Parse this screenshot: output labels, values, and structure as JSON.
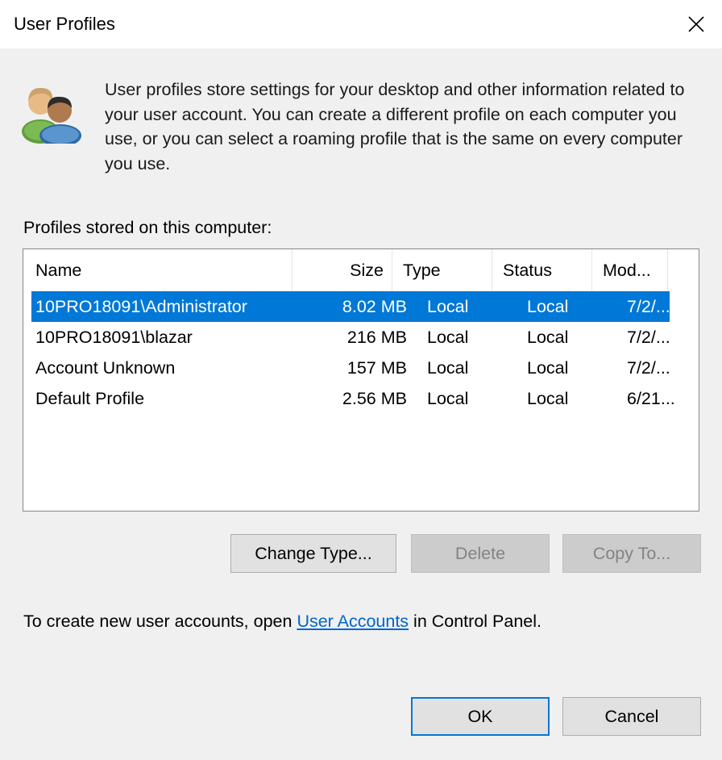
{
  "window": {
    "title": "User Profiles",
    "close_icon": "close-icon"
  },
  "intro": {
    "icon": "users-icon",
    "text": "User profiles store settings for your desktop and other information related to your user account. You can create a different profile on each computer you use, or you can select a roaming profile that is the same on every computer you use."
  },
  "profiles": {
    "label": "Profiles stored on this computer:",
    "columns": {
      "name": "Name",
      "size": "Size",
      "type": "Type",
      "status": "Status",
      "modified": "Mod..."
    },
    "rows": [
      {
        "name": "10PRO18091\\Administrator",
        "size": "8.02 MB",
        "type": "Local",
        "status": "Local",
        "modified": "7/2/...",
        "selected": true
      },
      {
        "name": "10PRO18091\\blazar",
        "size": "216 MB",
        "type": "Local",
        "status": "Local",
        "modified": "7/2/...",
        "selected": false
      },
      {
        "name": "Account Unknown",
        "size": "157 MB",
        "type": "Local",
        "status": "Local",
        "modified": "7/2/...",
        "selected": false
      },
      {
        "name": "Default Profile",
        "size": "2.56 MB",
        "type": "Local",
        "status": "Local",
        "modified": "6/21...",
        "selected": false
      }
    ]
  },
  "actions": {
    "change_type": "Change Type...",
    "delete": "Delete",
    "copy_to": "Copy To..."
  },
  "footer": {
    "prefix": "To create new user accounts, open ",
    "link": "User Accounts",
    "suffix": " in Control Panel."
  },
  "buttons": {
    "ok": "OK",
    "cancel": "Cancel"
  },
  "colors": {
    "selection": "#0078d7",
    "link": "#0066cc",
    "background": "#f0f0f0"
  }
}
